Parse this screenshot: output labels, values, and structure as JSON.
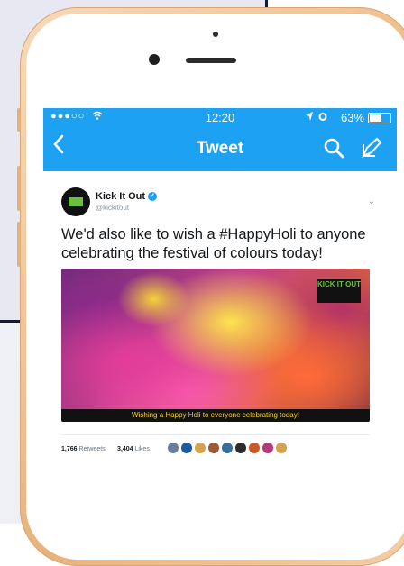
{
  "status_bar": {
    "signal": "●●●○○",
    "time": "12:20",
    "battery_text": "63%",
    "battery_level": 0.63
  },
  "nav": {
    "back_icon": "chevron-left-icon",
    "title": "Tweet",
    "search_icon": "search-icon",
    "compose_icon": "compose-icon"
  },
  "tweet": {
    "display_name": "Kick It Out",
    "handle": "@kickitout",
    "text": "We'd also like to wish a #HappyHoli to anyone celebrating the festival of colours today!",
    "media_caption": "Wishing a Happy Holi to everyone celebrating today!",
    "media_logo": "KICK IT OUT",
    "retweets_count": "1,766",
    "retweets_label": "Retweets",
    "likes_count": "3,404",
    "likes_label": "Likes"
  },
  "colors": {
    "twitter_blue": "#1da1f2",
    "frame_gold": "#f1c596"
  },
  "likers": [
    "#6b7b9a",
    "#1b5aa3",
    "#d4a24c",
    "#9b5a3a",
    "#3a6f9a",
    "#2b2b2b",
    "#c85a2a",
    "#b23a7a",
    "#d4a24c"
  ]
}
